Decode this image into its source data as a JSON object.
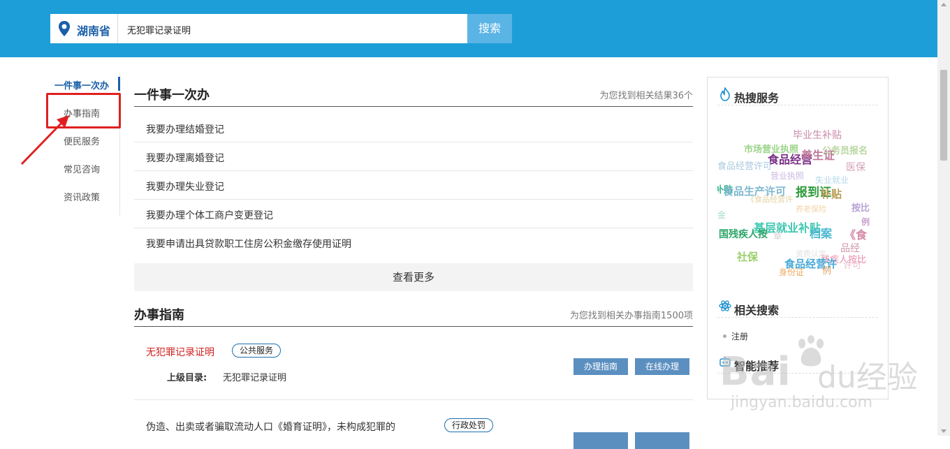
{
  "search": {
    "region": "湖南省",
    "query": "无犯罪记录证明",
    "button": "搜索"
  },
  "leftnav": {
    "items": [
      "一件事一次办",
      "办事指南",
      "便民服务",
      "常见咨询",
      "资讯政策"
    ]
  },
  "section_onething": {
    "title": "一件事一次办",
    "count": "为您找到相关结果36个",
    "rows": [
      "我要办理结婚登记",
      "我要办理离婚登记",
      "我要办理失业登记",
      "我要办理个体工商户变更登记",
      "我要申请出具贷款职工住房公积金缴存使用证明"
    ],
    "more": "查看更多"
  },
  "section_guide": {
    "title": "办事指南",
    "count": "为您找到相关办事指南1500项",
    "items": [
      {
        "title": "无犯罪记录证明",
        "tag": "公共服务",
        "sub_label": "上级目录:",
        "sub_value": "无犯罪记录证明",
        "btn_guide": "办理指南",
        "btn_online": "在线办理"
      },
      {
        "title": "伪造、出卖或者骗取流动人口《婚育证明》，未构成犯罪的",
        "tag": "行政处罚"
      }
    ]
  },
  "sidebar": {
    "hot_title": "热搜服务",
    "related_title": "相关搜索",
    "related_items": [
      "注册"
    ],
    "smart_title": "智能推荐"
  },
  "cloud_words": [
    {
      "t": "毕业生补贴",
      "c": "#c98aa8"
    },
    {
      "t": "市场营业执照",
      "c": "#9bd58a"
    },
    {
      "t": "公务员报名",
      "c": "#b9d7a0"
    },
    {
      "t": "食品经营",
      "c": "#7a2f86"
    },
    {
      "t": "养生证",
      "c": "#c07a9a"
    },
    {
      "t": "食品经营许可",
      "c": "#a9c8e0"
    },
    {
      "t": "医保",
      "c": "#d4a0b5"
    },
    {
      "t": "营业执照",
      "c": "#c9b7e2"
    },
    {
      "t": "失业就业",
      "c": "#b7d8ea"
    },
    {
      "t": "补贴",
      "c": "#35b58b"
    },
    {
      "t": "食品生产许可",
      "c": "#7fb8d0"
    },
    {
      "t": "报到证",
      "c": "#2e9a3a"
    },
    {
      "t": "补贴",
      "c": "#b89a50"
    },
    {
      "t": "《食品经营许",
      "c": "#e2d0a0"
    },
    {
      "t": "按比",
      "c": "#b7a0d6"
    },
    {
      "t": "金",
      "c": "#a5dcc2"
    },
    {
      "t": "养老保险",
      "c": "#f2d3a8"
    },
    {
      "t": "例",
      "c": "#c9a0d0"
    },
    {
      "t": "基层就业补贴",
      "c": "#3dc8b0"
    },
    {
      "t": "档案",
      "c": "#4ab8d0"
    },
    {
      "t": "《食",
      "c": "#d48aa5"
    },
    {
      "t": "国残疾人按",
      "c": "#2fa56a"
    },
    {
      "t": "章",
      "c": "#d0d0d0"
    },
    {
      "t": "品经",
      "c": "#d098b0"
    },
    {
      "t": "社保",
      "c": "#9ad06a"
    },
    {
      "t": "残疾人按比",
      "c": "#e88aa8"
    },
    {
      "t": "食品经营许",
      "c": "#48a9d8"
    },
    {
      "t": "例",
      "c": "#e0a060"
    },
    {
      "t": "身份证",
      "c": "#f0a860"
    },
    {
      "t": "许可",
      "c": "#e6c0d0"
    },
    {
      "t": "资质认定",
      "c": "#e0e0e0"
    }
  ],
  "watermark": {
    "brand": "Bai",
    "brand2": "du经验",
    "url": "jingyan.baidu.com"
  },
  "colors": {
    "topbar": "#1e9ed8",
    "accent": "#1a5fa8",
    "highlight_red": "#e02020",
    "button": "#5b8fc0"
  }
}
